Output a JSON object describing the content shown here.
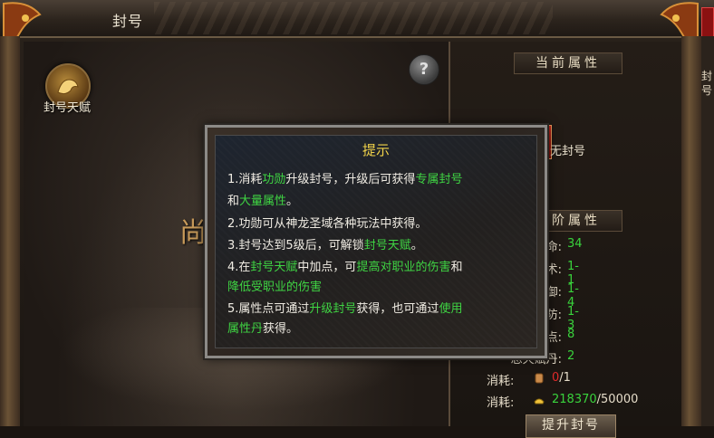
{
  "window": {
    "title": "封号"
  },
  "far_right_text": "封号",
  "left_panel": {
    "talent_label": "封号天赋",
    "help_label": "?",
    "center_char": "尚"
  },
  "right_panel": {
    "current_header": "当前属性",
    "current_title": "无封号",
    "close_label": "✕",
    "next_header": "下阶属性",
    "attributes": [
      {
        "label": "命:",
        "value": "34"
      },
      {
        "label": "术:",
        "value": "1-1"
      },
      {
        "label": "御:",
        "value": "1-4"
      },
      {
        "label": "防:",
        "value": "1-3"
      },
      {
        "label": "赋点:",
        "value": "8"
      },
      {
        "label": "总天赋丹:",
        "value": "2"
      }
    ],
    "costs": [
      {
        "label": "消耗:",
        "icon": "scroll-icon",
        "current": "0",
        "required": "/1",
        "current_color": "#e02a2a"
      },
      {
        "label": "消耗:",
        "icon": "gold-ingot-icon",
        "current": "218370",
        "required": "/50000",
        "current_color": "#39d23c"
      }
    ],
    "upgrade_button": "提升封号"
  },
  "tooltip": {
    "title": "提示",
    "lines": [
      [
        {
          "t": "1.消耗"
        },
        {
          "t": "功勋",
          "hl": true
        },
        {
          "t": "升级封号，升级后可获得"
        },
        {
          "t": "专属封号",
          "hl": true
        }
      ],
      [
        {
          "t": "和"
        },
        {
          "t": "大量属性",
          "hl": true
        },
        {
          "t": "。"
        }
      ],
      [
        {
          "t": "2.功勋可从神龙圣域各种玩法中获得。"
        }
      ],
      [
        {
          "t": "3.封号达到5级后，可解锁"
        },
        {
          "t": "封号天赋",
          "hl": true
        },
        {
          "t": "。"
        }
      ],
      [
        {
          "t": "4.在"
        },
        {
          "t": "封号天赋",
          "hl": true
        },
        {
          "t": "中加点，可"
        },
        {
          "t": "提高对职业的伤害",
          "hl": true
        },
        {
          "t": "和"
        }
      ],
      [
        {
          "t": "降低受职业的伤害",
          "hl": true
        }
      ],
      [
        {
          "t": "5.属性点可通过"
        },
        {
          "t": "升级封号",
          "hl": true
        },
        {
          "t": "获得，也可通过"
        },
        {
          "t": "使用",
          "hl": true
        }
      ],
      [
        {
          "t": "属性丹",
          "hl": true
        },
        {
          "t": "获得。"
        }
      ]
    ]
  },
  "colors": {
    "highlight": "#3fd443",
    "title_gold": "#f2d44a",
    "value_green": "#39d23c",
    "value_red": "#e02a2a"
  }
}
